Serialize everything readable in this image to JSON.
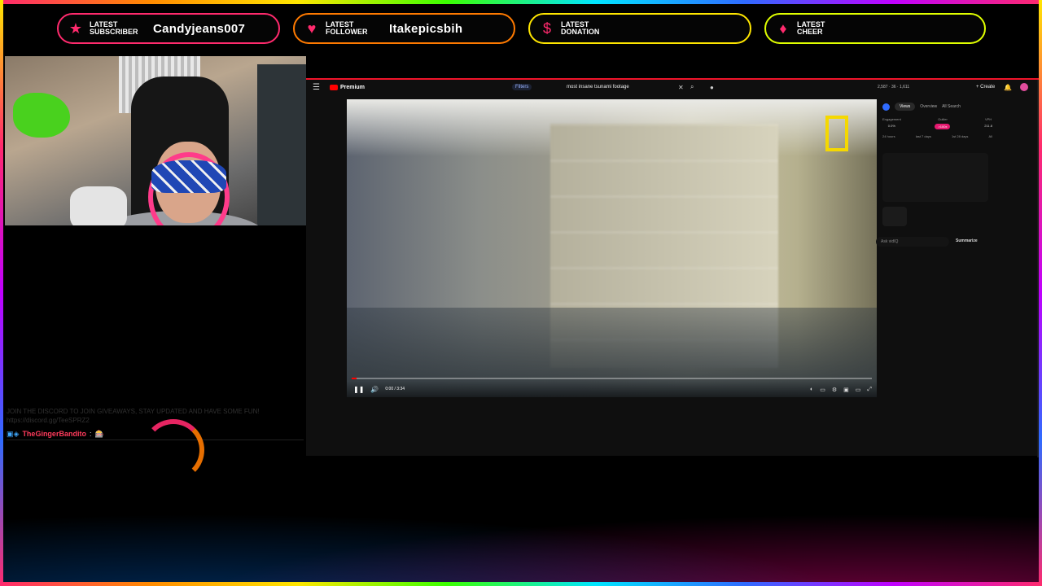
{
  "alerts": [
    {
      "label_line1": "LATEST",
      "label_line2": "SUBSCRIBER",
      "value": "Candyjeans007",
      "icon": "star-icon",
      "color": "#ff2a6d"
    },
    {
      "label_line1": "LATEST",
      "label_line2": "FOLLOWER",
      "value": "Itakepicsbih",
      "icon": "heart-icon",
      "color": "#ff7a00"
    },
    {
      "label_line1": "LATEST",
      "label_line2": "DONATION",
      "value": "",
      "icon": "dollar-icon",
      "color": "#ffe600"
    },
    {
      "label_line1": "LATEST",
      "label_line2": "CHEER",
      "value": "",
      "icon": "diamond-icon",
      "color": "#e0ff00"
    }
  ],
  "chat": {
    "faded_text": "JOIN THE DISCORD TO JOIN GIVEAWAYS, STAY UPDATED AND HAVE SOME FUN! https://discord.gg/TeeSPRZ2",
    "message": {
      "user": "TheGingerBandito",
      "colon": ":",
      "text": "🎰"
    }
  },
  "youtube": {
    "brand": "Premium",
    "filters_label": "Filters",
    "search_query": "most insane tsunami footage",
    "stats": "2,587 · 36 · 1,611",
    "create_label": "Create",
    "player": {
      "time": "0:00 / 3:34",
      "progress_fraction": 0.01
    },
    "side": {
      "tabs": [
        "Views",
        "Overview",
        "All Search"
      ],
      "metrics": [
        {
          "label": "Engagement",
          "value": "0.0%"
        },
        {
          "label": "Outlier",
          "value": ">100x"
        },
        {
          "label": "VPH",
          "value": "211.8"
        }
      ],
      "ranges": [
        "24 hours",
        "last 7 days",
        "1st 28 days",
        "All"
      ],
      "ask_placeholder": "Ask vidIQ",
      "summarize_label": "Summarize"
    }
  }
}
